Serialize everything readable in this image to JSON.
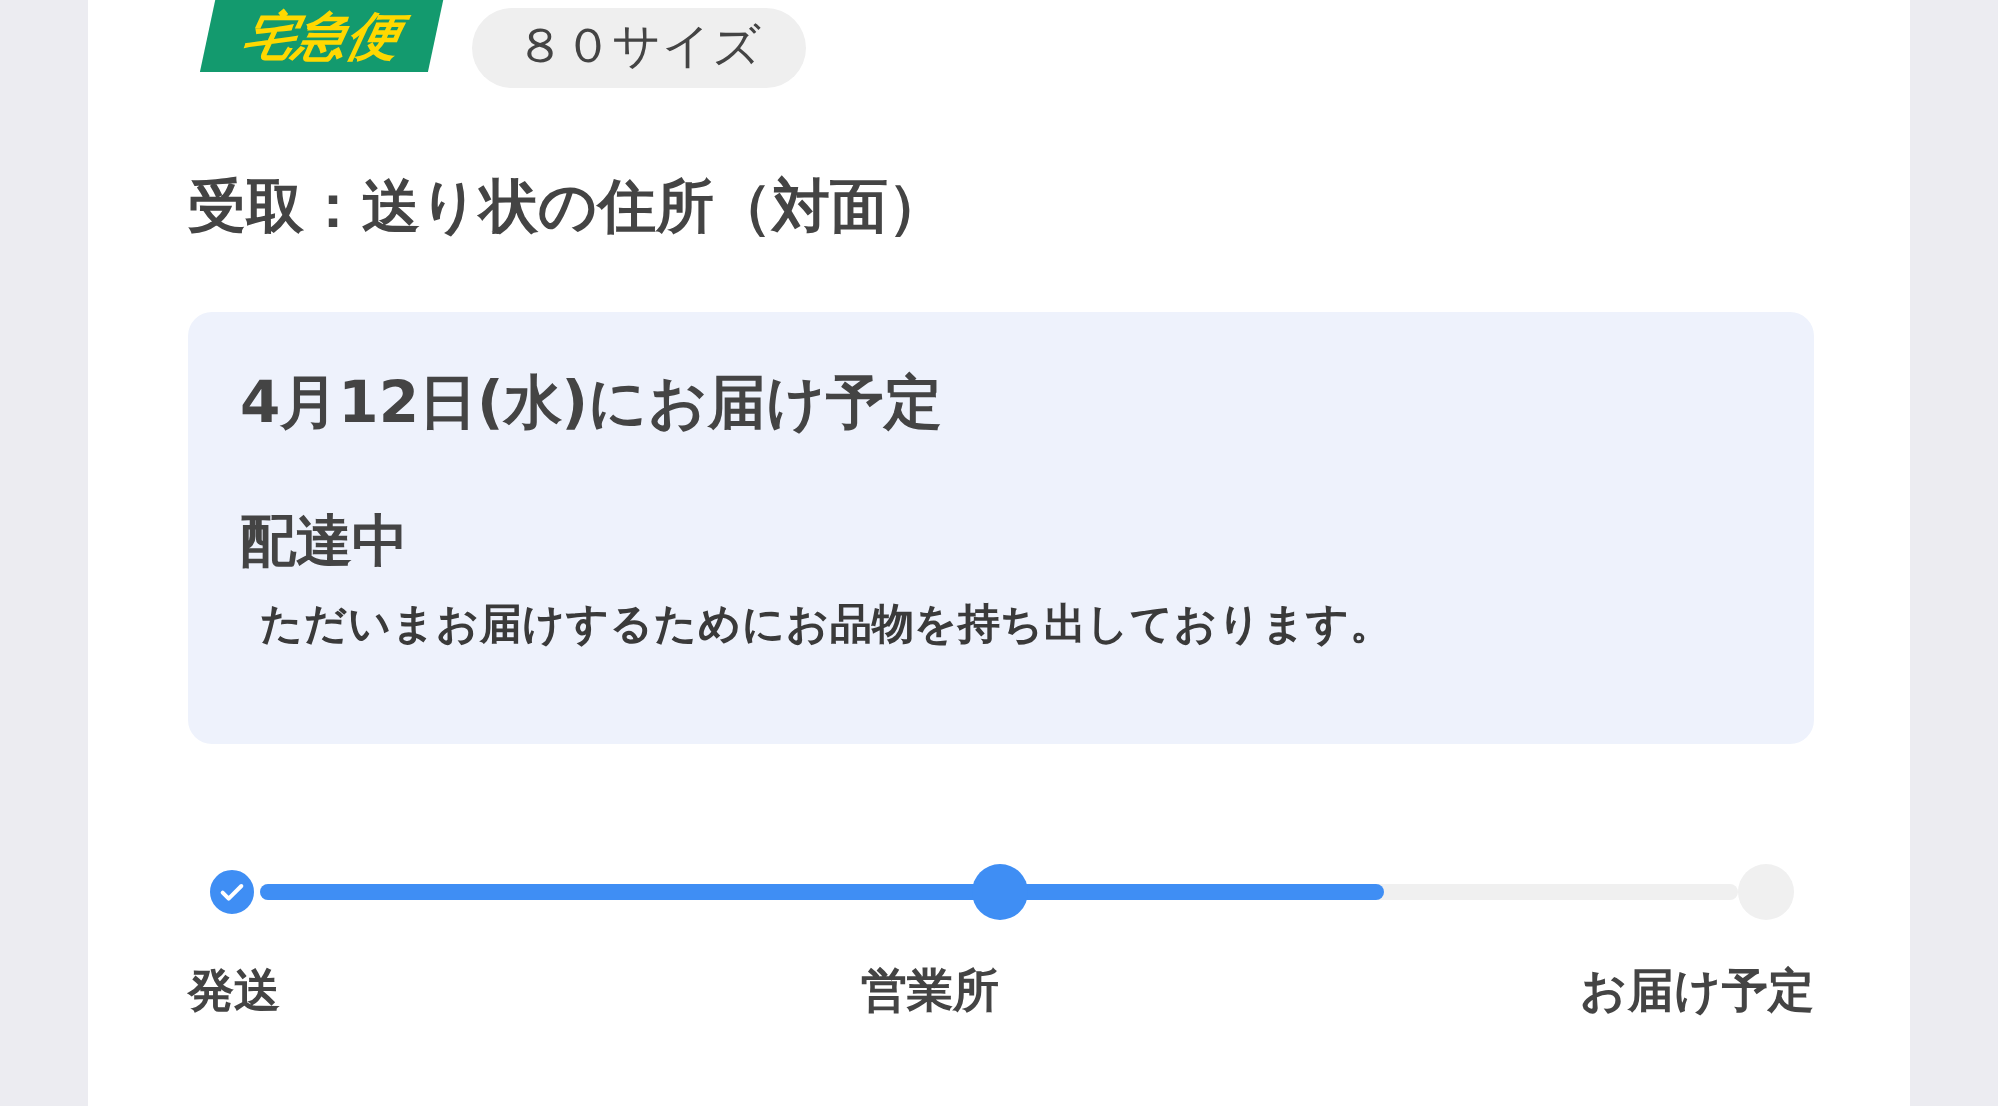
{
  "carrier": {
    "logo_text": "宅急便",
    "size": "８０サイズ"
  },
  "receipt": "受取：送り状の住所（対面）",
  "status_box": {
    "delivery_date": "4月12日(水)にお届け予定",
    "status": "配達中",
    "message": "ただいまお届けするためにお品物を持ち出しております。"
  },
  "progress": {
    "level": 0.76,
    "steps": [
      {
        "label": "発送",
        "checked": true,
        "reached": true
      },
      {
        "label": "営業所",
        "checked": false,
        "reached": true
      },
      {
        "label": "お届け予定",
        "checked": false,
        "reached": false
      }
    ]
  }
}
